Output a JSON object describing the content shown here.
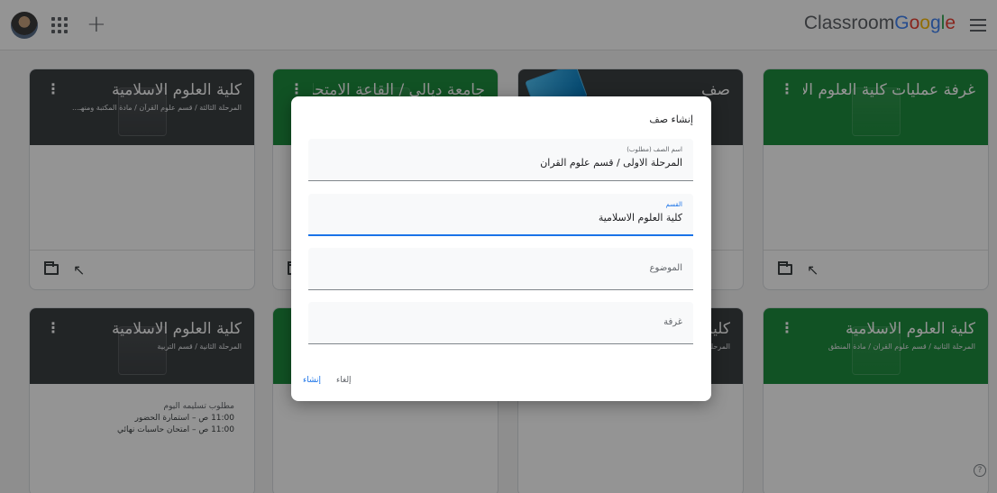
{
  "header": {
    "brand_word": "Classroom",
    "brand_google": [
      "G",
      "o",
      "o",
      "g",
      "l",
      "e"
    ],
    "brand_colors": [
      "#4285f4",
      "#ea4335",
      "#fbbc05",
      "#4285f4",
      "#34a853",
      "#ea4335"
    ],
    "icons": [
      "avatar",
      "apps-grid-icon",
      "plus-icon",
      "hamburger-menu-icon"
    ]
  },
  "cards": [
    {
      "title": "كلية العلوم الاسلامية",
      "subtitle": "المرحلة الثالثة / قسم علوم القرآن / مادة المكتبة ومنهـ..."
    },
    {
      "title": "جامعة ديالى / القاعة الامتحانية",
      "subtitle": ""
    },
    {
      "title": "صف",
      "subtitle": ""
    },
    {
      "title": "غرفة عمليات كلية العلوم الاس...",
      "subtitle": ""
    },
    {
      "title": "كلية العلوم الاسلامية",
      "subtitle": "المرحلة الثانية / قسم التربية",
      "due_label": "مطلوب تسليمه اليوم",
      "due_items": [
        "11:00 ص – استمارة الحضور",
        "11:00 ص – امتحان حاسبات نهائي"
      ]
    },
    {
      "title": "",
      "subtitle": ""
    },
    {
      "title": "كلية",
      "subtitle": "المرحلة"
    },
    {
      "title": "كلية العلوم الاسلامية",
      "subtitle": "المرحلة الثانية / قسم علوم القران / مادة المنطق"
    }
  ],
  "colors": {
    "header_dark": "#3c4043",
    "header_green": "#1e8e3e",
    "header_teal": "#00897b",
    "accent_blue": "#1a73e8"
  },
  "dialog": {
    "title": "إنشاء صف",
    "fields": {
      "class_name": {
        "label": "اسم الصف (مطلوب)",
        "value": "المرحلة الاولى / قسم علوم القران"
      },
      "section": {
        "label": "القسم",
        "value": "كلية العلوم الاسلامية"
      },
      "subject": {
        "placeholder": "الموضوع"
      },
      "room": {
        "placeholder": "غرفة"
      }
    },
    "actions": {
      "create": "إنشاء",
      "cancel": "إلغاء"
    }
  }
}
